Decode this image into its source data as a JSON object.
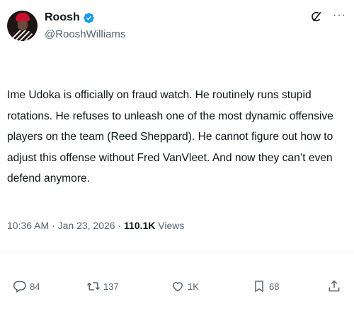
{
  "author": {
    "display_name": "Roosh",
    "handle": "@RooshWilliams",
    "verified": true
  },
  "tweet": {
    "text": "Ime Udoka is officially on fraud watch. He routinely runs stupid rotations. He refuses to unleash one of the most dynamic offensive players on the team (Reed Sheppard). He cannot figure out how to adjust this offense without Fred VanVleet. And now they can’t even defend anymore.",
    "time": "10:36 AM",
    "date": "Jan 23, 2026",
    "separator": "·",
    "views_count": "110.1K",
    "views_label": "Views"
  },
  "actions": {
    "replies": "84",
    "reposts": "137",
    "likes": "1K",
    "bookmarks": "68"
  },
  "header": {
    "more_label": "···"
  },
  "colors": {
    "text": "#0f1419",
    "secondary": "#536471",
    "verified": "#1d9bf0"
  },
  "icons": {
    "verified": "verified-badge-icon",
    "grok": "grok-icon",
    "more": "more-icon",
    "reply": "reply-icon",
    "repost": "repost-icon",
    "like": "heart-icon",
    "bookmark": "bookmark-icon",
    "share": "share-icon"
  }
}
